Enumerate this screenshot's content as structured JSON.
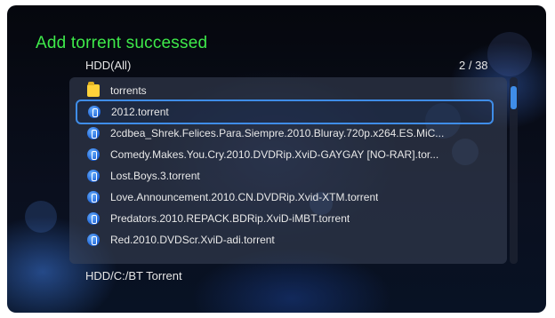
{
  "header": {
    "title": "Add torrent successed",
    "location": "HDD(All)",
    "page_count": "2 / 38"
  },
  "list": {
    "items": [
      {
        "label": "torrents",
        "icon": "folder-icon"
      },
      {
        "label": "2012.torrent",
        "icon": "torrent-file-icon",
        "selected": true
      },
      {
        "label": "2cdbea_Shrek.Felices.Para.Siempre.2010.Bluray.720p.x264.ES.MiC...",
        "icon": "torrent-file-icon"
      },
      {
        "label": "Comedy.Makes.You.Cry.2010.DVDRip.XviD-GAYGAY [NO-RAR].tor...",
        "icon": "torrent-file-icon"
      },
      {
        "label": "Lost.Boys.3.torrent",
        "icon": "torrent-file-icon"
      },
      {
        "label": "Love.Announcement.2010.CN.DVDRip.Xvid-XTM.torrent",
        "icon": "torrent-file-icon"
      },
      {
        "label": "Predators.2010.REPACK.BDRip.XviD-iMBT.torrent",
        "icon": "torrent-file-icon"
      },
      {
        "label": "Red.2010.DVDScr.XviD-adi.torrent",
        "icon": "torrent-file-icon"
      }
    ]
  },
  "footer": {
    "path": "HDD/C:/BT Torrent"
  },
  "colors": {
    "title": "#3ee94a",
    "selection": "#3f8de8",
    "folder": "#ffd23a",
    "torrent_icon": "#1d63d6"
  }
}
